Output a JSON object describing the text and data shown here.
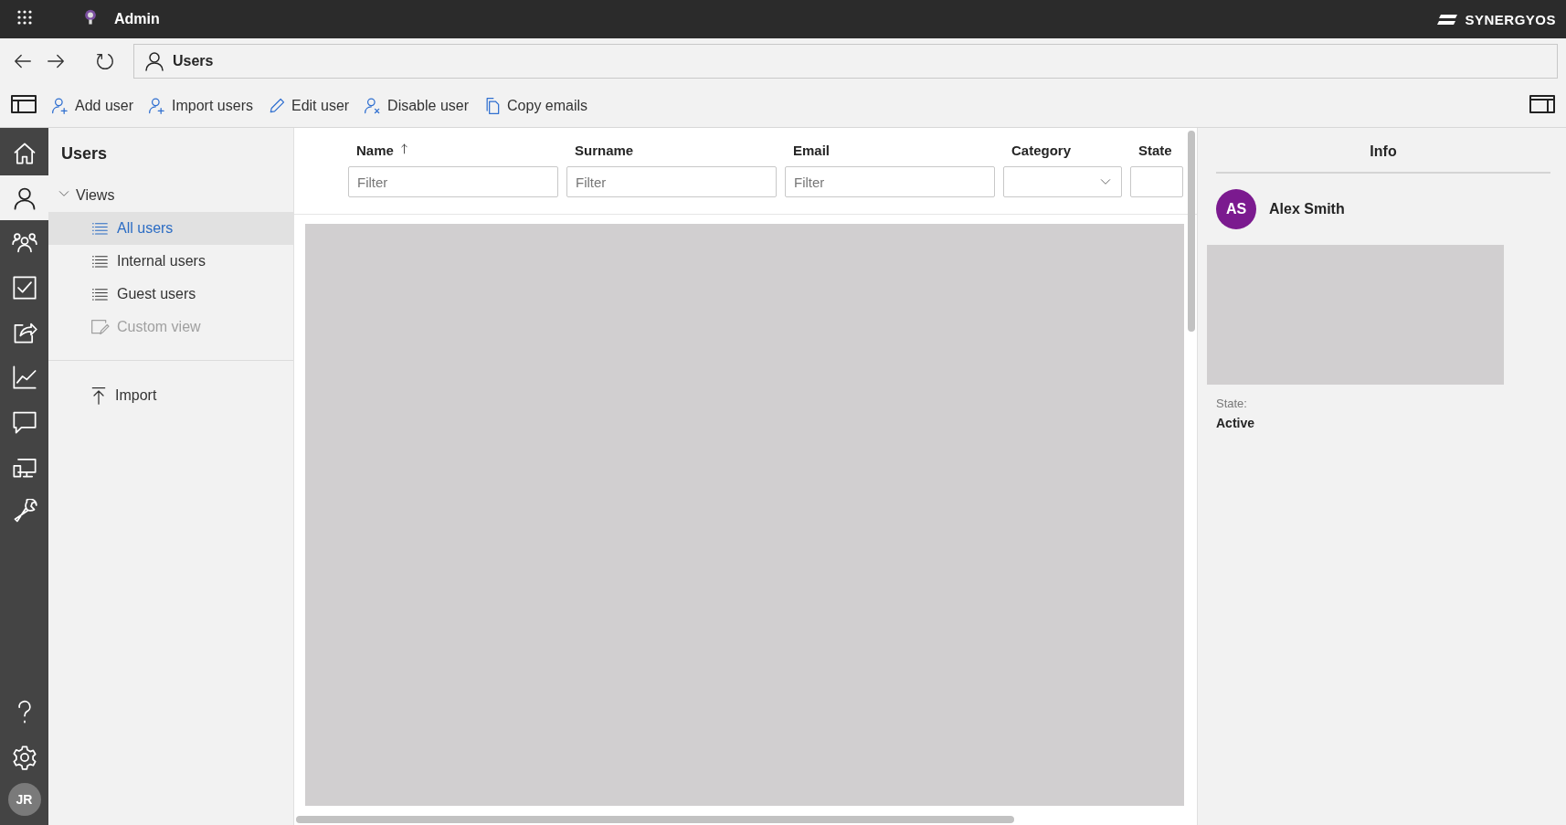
{
  "top_bar": {
    "app_name": "Admin",
    "brand": "SYNERGYOS"
  },
  "address_bar": {
    "title": "Users"
  },
  "toolbar": {
    "actions": [
      {
        "label": "Add user",
        "kind": "add-user"
      },
      {
        "label": "Import users",
        "kind": "add-user"
      },
      {
        "label": "Edit user",
        "kind": "edit"
      },
      {
        "label": "Disable user",
        "kind": "disable-user"
      },
      {
        "label": "Copy emails",
        "kind": "copy"
      }
    ]
  },
  "rail": {
    "items": [
      {
        "kind": "home",
        "selected": false
      },
      {
        "kind": "user",
        "selected": true
      },
      {
        "kind": "group",
        "selected": false
      },
      {
        "kind": "check",
        "selected": false
      },
      {
        "kind": "share",
        "selected": false
      },
      {
        "kind": "chart",
        "selected": false
      },
      {
        "kind": "chat",
        "selected": false
      },
      {
        "kind": "device",
        "selected": false
      },
      {
        "kind": "wrench",
        "selected": false
      }
    ],
    "bottom": [
      {
        "kind": "help"
      },
      {
        "kind": "settings"
      }
    ],
    "avatar": "JR"
  },
  "sidebar": {
    "title": "Users",
    "group": {
      "label": "Views",
      "expanded": true,
      "children": [
        {
          "label": "All users",
          "kind": "list",
          "selected": true,
          "disabled": false
        },
        {
          "label": "Internal users",
          "kind": "list",
          "selected": false,
          "disabled": false
        },
        {
          "label": "Guest users",
          "kind": "list",
          "selected": false,
          "disabled": false
        },
        {
          "label": "Custom view",
          "kind": "custom",
          "selected": false,
          "disabled": true
        }
      ]
    },
    "items": [
      {
        "label": "Import",
        "kind": "import",
        "selected": false,
        "disabled": false
      }
    ]
  },
  "table": {
    "columns": [
      {
        "label": "Name",
        "sorted": true,
        "kind": "text",
        "placeholder": "Filter"
      },
      {
        "label": "Surname",
        "sorted": false,
        "kind": "text",
        "placeholder": "Filter"
      },
      {
        "label": "Email",
        "sorted": false,
        "kind": "text",
        "placeholder": "Filter"
      },
      {
        "label": "Category",
        "sorted": false,
        "kind": "select"
      },
      {
        "label": "State",
        "sorted": false,
        "kind": "text"
      }
    ]
  },
  "info": {
    "title": "Info",
    "user": {
      "initials": "AS",
      "name": "Alex Smith"
    },
    "fields": [
      {
        "label": "State:",
        "value": "Active"
      }
    ]
  }
}
